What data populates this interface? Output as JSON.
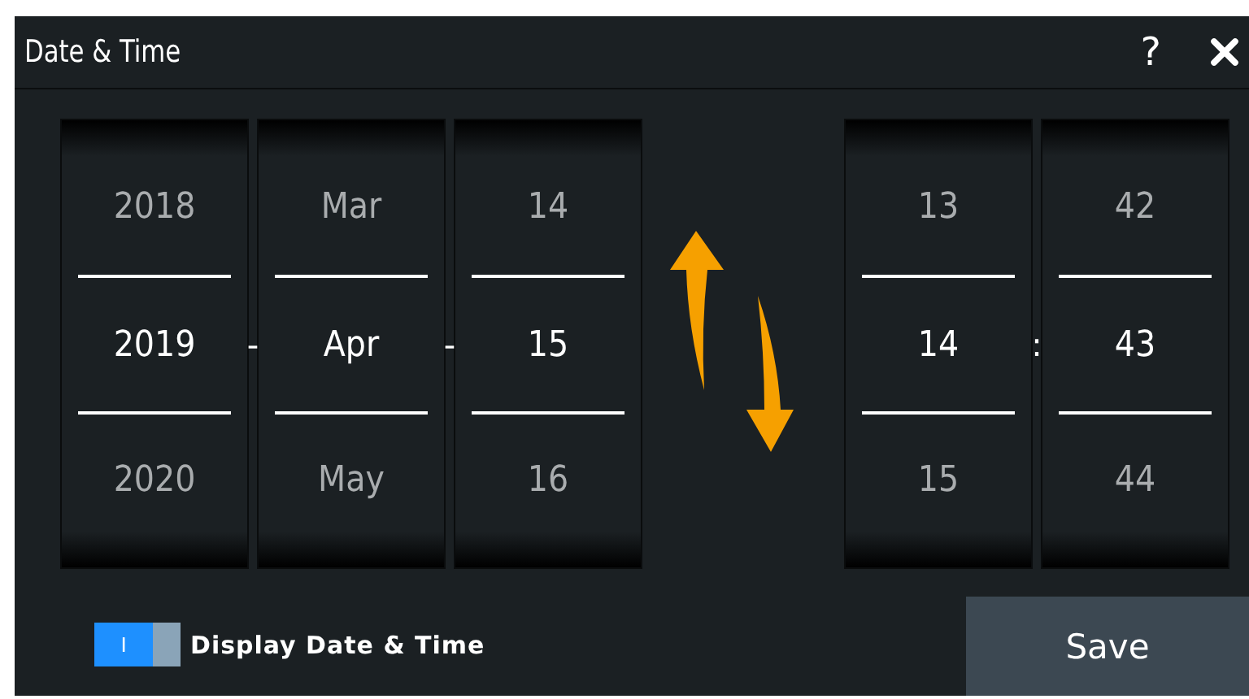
{
  "window": {
    "title": "Date & Time",
    "help": "?"
  },
  "date": [
    {
      "kind": "wheel",
      "values": [
        {
          "text": "2018",
          "selected": false
        },
        {
          "text": "2019",
          "selected": true
        },
        {
          "text": "2020",
          "selected": false
        }
      ]
    },
    {
      "kind": "separator",
      "text": "-"
    },
    {
      "kind": "wheel",
      "values": [
        {
          "text": "Mar",
          "selected": false
        },
        {
          "text": "Apr",
          "selected": true
        },
        {
          "text": "May",
          "selected": false
        }
      ]
    },
    {
      "kind": "separator",
      "text": "-"
    },
    {
      "kind": "wheel",
      "values": [
        {
          "text": "14",
          "selected": false
        },
        {
          "text": "15",
          "selected": true
        },
        {
          "text": "16",
          "selected": false
        }
      ]
    }
  ],
  "time": [
    {
      "kind": "wheel",
      "values": [
        {
          "text": "13",
          "selected": false
        },
        {
          "text": "14",
          "selected": true
        },
        {
          "text": "15",
          "selected": false
        }
      ]
    },
    {
      "kind": "separator",
      "text": ":"
    },
    {
      "kind": "wheel",
      "values": [
        {
          "text": "42",
          "selected": false
        },
        {
          "text": "43",
          "selected": true
        },
        {
          "text": "44",
          "selected": false
        }
      ]
    }
  ],
  "display_toggle": {
    "label": "Display Date & Time",
    "glyph": "I",
    "on": true
  },
  "buttons": [
    {
      "label": "Save"
    }
  ]
}
